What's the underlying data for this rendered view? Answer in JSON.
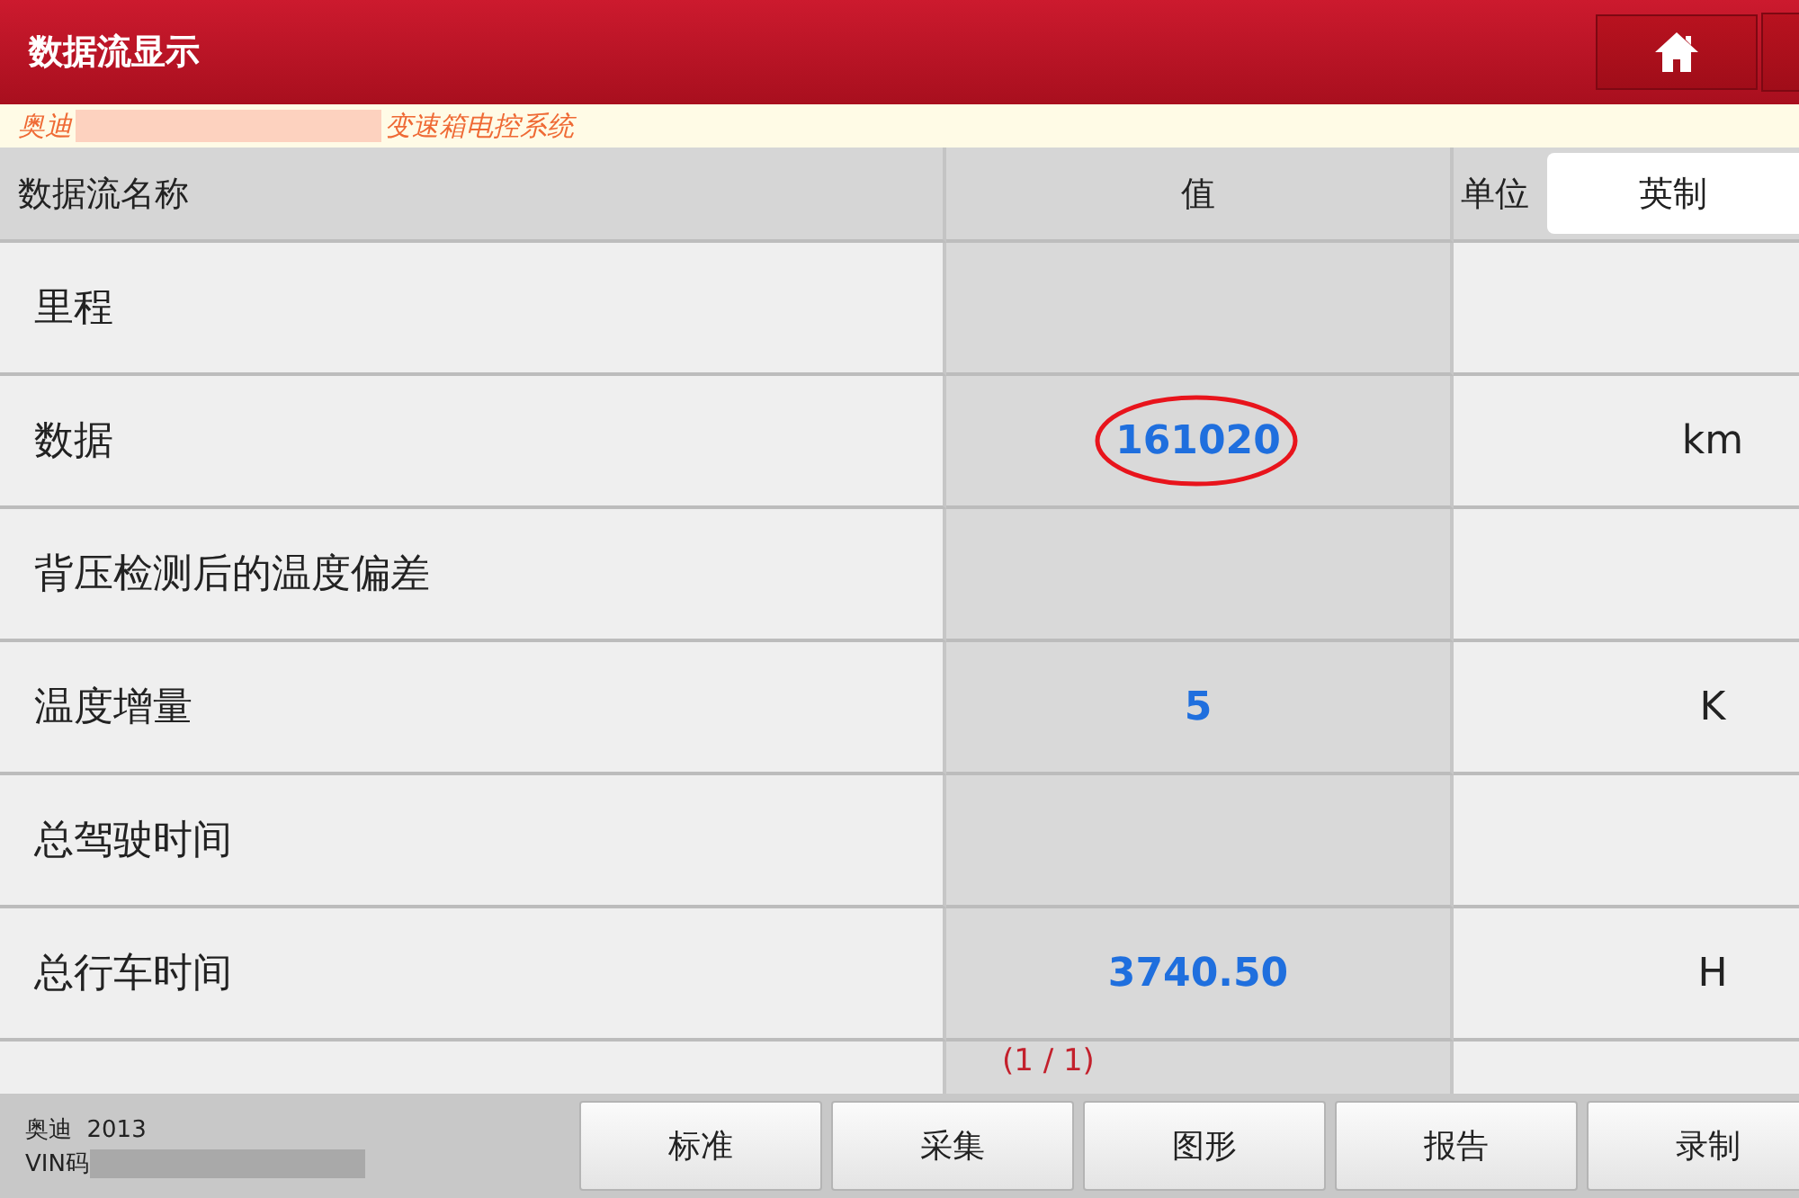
{
  "header": {
    "title": "数据流显示"
  },
  "subtitle": {
    "make": "奥迪",
    "system": "变速箱电控系统"
  },
  "table": {
    "columns": [
      "数据流名称",
      "值"
    ],
    "unit_label": "单位",
    "unit_toggle": "英制",
    "rows": [
      {
        "name": "里程",
        "circled": false
      },
      {
        "name": "数据",
        "value": "161020",
        "unit": "km",
        "circled": true
      },
      {
        "name": "背压检测后的温度偏差",
        "circled": false
      },
      {
        "name": "温度增量",
        "value": "5",
        "unit": "K",
        "circled": false
      },
      {
        "name": "总驾驶时间",
        "circled": false
      },
      {
        "name": "总行车时间",
        "value": "3740.50",
        "unit": "H",
        "circled": false
      }
    ]
  },
  "page_indicator": "(1 / 1)",
  "footer": {
    "vehicle": "奥迪  2013",
    "vin_label": "VIN码",
    "buttons": [
      "标准",
      "采集",
      "图形",
      "报告",
      "录制"
    ]
  }
}
